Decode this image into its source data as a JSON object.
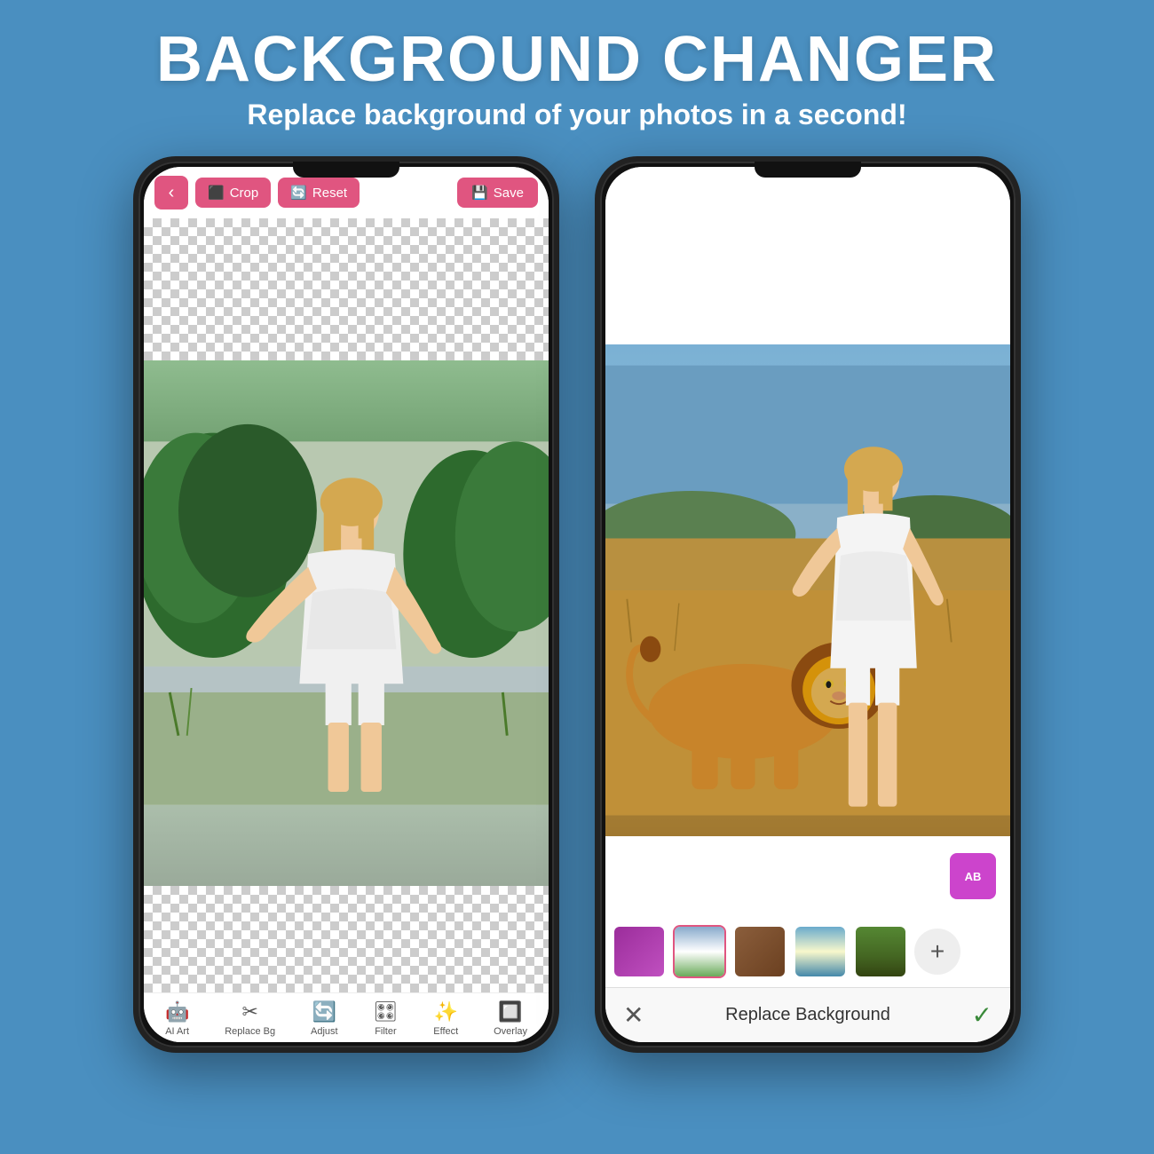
{
  "header": {
    "title": "BACKGROUND CHANGER",
    "subtitle": "Replace background of your photos in a second!"
  },
  "left_phone": {
    "toolbar": {
      "back_label": "‹",
      "crop_label": "Crop",
      "reset_label": "Reset",
      "save_label": "Save"
    },
    "nav_items": [
      {
        "icon": "🤖",
        "label": "AI Art"
      },
      {
        "icon": "✂",
        "label": "Replace Bg"
      },
      {
        "icon": "🔄",
        "label": "Adjust"
      },
      {
        "icon": "🎛",
        "label": "Filter"
      },
      {
        "icon": "✨",
        "label": "Effect"
      },
      {
        "icon": "🔲",
        "label": "Overlay"
      }
    ]
  },
  "right_phone": {
    "bg_thumbs": [
      {
        "id": "purple",
        "color": "#9b2d9b"
      },
      {
        "id": "white-house",
        "color": "#4488aa"
      },
      {
        "id": "wood",
        "color": "#8B5E3C"
      },
      {
        "id": "lake",
        "color": "#5588bb"
      },
      {
        "id": "forest",
        "color": "#336633"
      },
      {
        "id": "savanna",
        "color": "#c8a060"
      }
    ],
    "bottom_bar": {
      "cancel_label": "✕",
      "replace_bg_label": "Replace Background",
      "check_label": "✓"
    }
  }
}
